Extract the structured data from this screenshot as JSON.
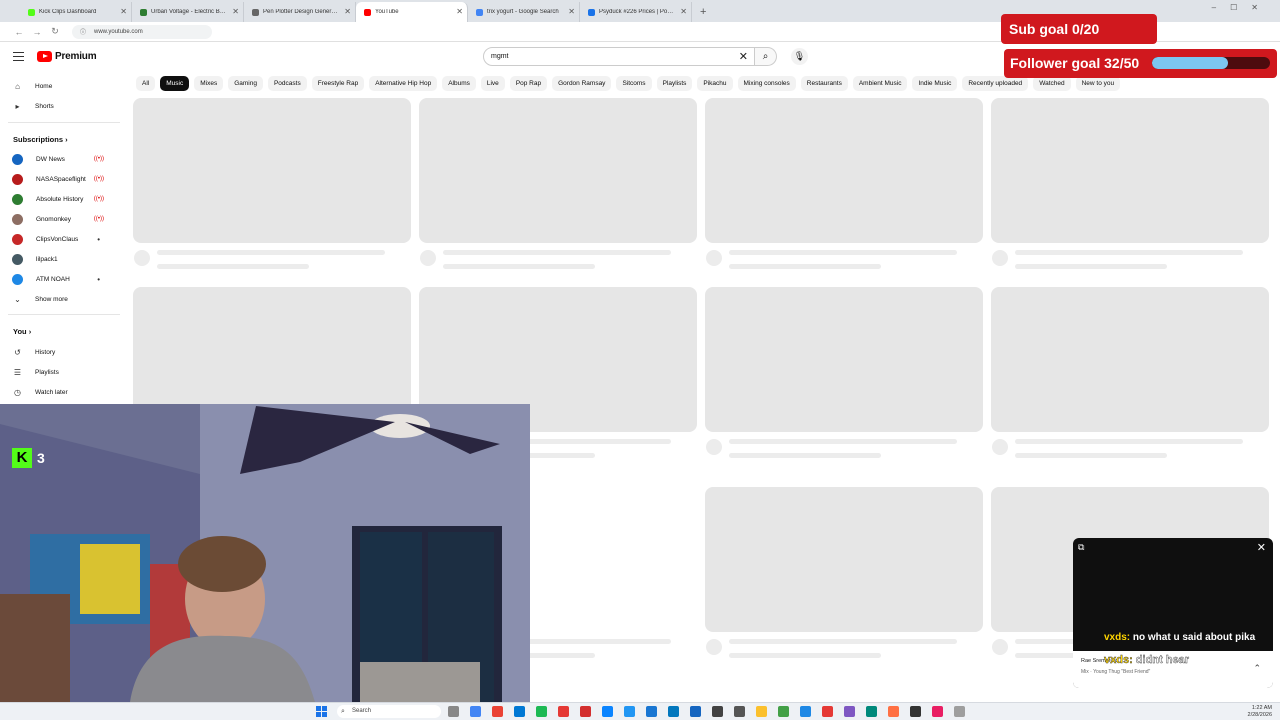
{
  "browser": {
    "tabs": [
      {
        "title": "Kick Clips Dashboard",
        "color": "#53fc18"
      },
      {
        "title": "Urban Voltage - Electric Bikes & ...",
        "color": "#2e7d32"
      },
      {
        "title": "Pen Plotter Design Generator",
        "color": "#666666"
      },
      {
        "title": "YouTube",
        "color": "#ff0000",
        "active": true
      },
      {
        "title": "trix yogurt - Google Search",
        "color": "#4285f4"
      },
      {
        "title": "Psyduck #226 Prices | Pokemon ...",
        "color": "#1a73e8"
      }
    ],
    "new_tab": "+",
    "url": "www.youtube.com"
  },
  "youtube": {
    "logo": "Premium",
    "search_value": "mgmt",
    "chips": [
      "All",
      "Music",
      "Mixes",
      "Gaming",
      "Podcasts",
      "Freestyle Rap",
      "Alternative Hip Hop",
      "Albums",
      "Live",
      "Pop Rap",
      "Gordon Ramsay",
      "Sitcoms",
      "Playlists",
      "Pikachu",
      "Mixing consoles",
      "Restaurants",
      "Ambient Music",
      "Indie Music",
      "Recently uploaded",
      "Watched",
      "New to you"
    ],
    "selected_chip": "Music"
  },
  "sidebar": {
    "home": "Home",
    "shorts": "Shorts",
    "subscriptions_heading": "Subscriptions",
    "subscriptions": [
      {
        "name": "DW News",
        "status": "live",
        "color": "#1565c0"
      },
      {
        "name": "NASASpaceflight",
        "status": "live",
        "color": "#b71c1c"
      },
      {
        "name": "Absolute History",
        "status": "live",
        "color": "#2e7d32"
      },
      {
        "name": "Gnomonkey",
        "status": "live",
        "color": "#8d6e63"
      },
      {
        "name": "ClipsVonClaus",
        "status": "dot",
        "color": "#c62828"
      },
      {
        "name": "lilpack1",
        "status": "none",
        "color": "#455a64"
      },
      {
        "name": "ATM NOAH",
        "status": "dot",
        "color": "#1e88e5"
      }
    ],
    "show_more": "Show more",
    "you_heading": "You",
    "you_items": [
      "History",
      "Playlists",
      "Watch later"
    ]
  },
  "overlay": {
    "sub_goal": "Sub goal 0/20",
    "follower_goal": "Follower goal 32/50",
    "follower_progress": 0.64,
    "kick_viewers": "3",
    "kick_logo": "K"
  },
  "miniplayer": {
    "chat1_user": "vxds:",
    "chat1_text": " no what u said about pika",
    "chat2_user": "vxds:",
    "chat2_text": " didnt hear",
    "track_artist": "Rae Sremmurd",
    "track_sub": "Mix · Young Thug \"Best Friend\""
  },
  "taskbar": {
    "search": "Search",
    "time": "1:22 AM",
    "date": "2/28/2026"
  }
}
